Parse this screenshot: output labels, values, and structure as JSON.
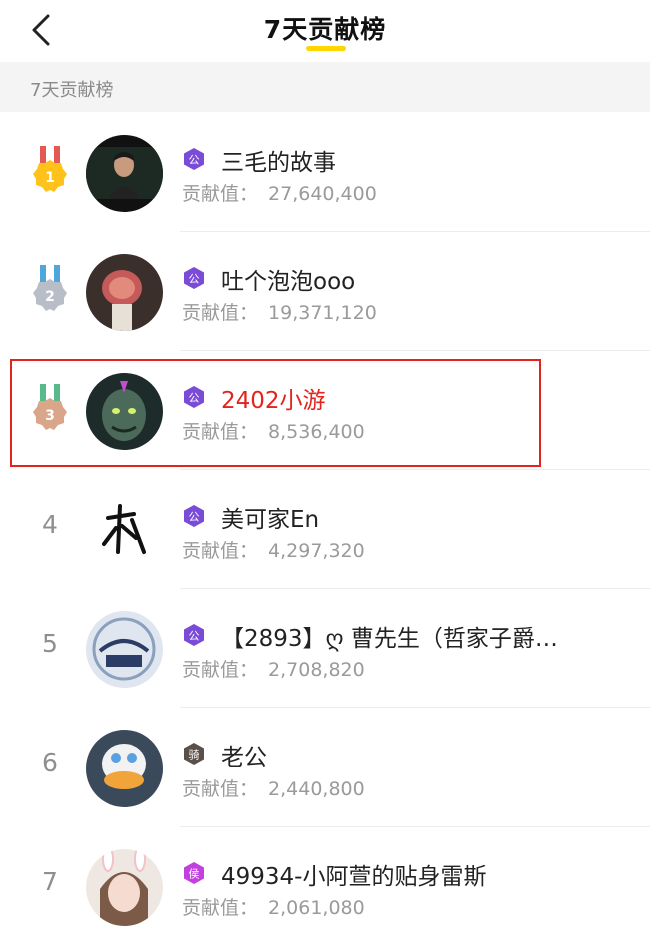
{
  "header": {
    "title": "7天贡献榜"
  },
  "section": {
    "label": "7天贡献榜"
  },
  "contrib_label": "贡献值：",
  "rows": [
    {
      "rank": "1",
      "medal_color": "#FFC21A",
      "badge": "公",
      "badge_color": "#7A4BD6",
      "name": "三毛的故事",
      "value": "27,640,400",
      "highlight": false
    },
    {
      "rank": "2",
      "medal_color": "#B9BDC7",
      "badge": "公",
      "badge_color": "#7A4BD6",
      "name": "吐个泡泡ooo",
      "value": "19,371,120",
      "highlight": false
    },
    {
      "rank": "3",
      "medal_color": "#D9A68A",
      "badge": "公",
      "badge_color": "#7A4BD6",
      "name": "2402小游",
      "value": "8,536,400",
      "highlight": true
    },
    {
      "rank": "4",
      "badge": "公",
      "badge_color": "#7A4BD6",
      "name": "美可家En",
      "value": "4,297,320",
      "highlight": false
    },
    {
      "rank": "5",
      "badge": "公",
      "badge_color": "#7A4BD6",
      "name": "【2893】ღ 曹先生（哲家子爵…",
      "value": "2,708,820",
      "highlight": false
    },
    {
      "rank": "6",
      "badge": "骑",
      "badge_color": "#5B5049",
      "name": "老公",
      "value": "2,440,800",
      "highlight": false
    },
    {
      "rank": "7",
      "badge": "侯",
      "badge_color": "#C23FE0",
      "name": "49934-小阿萱的贴身雷斯",
      "value": "2,061,080",
      "highlight": false
    }
  ]
}
